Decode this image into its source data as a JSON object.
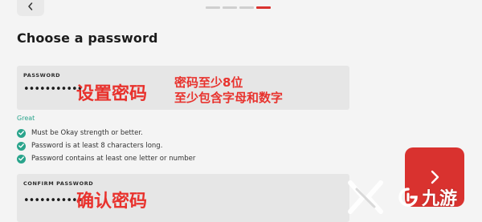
{
  "progress": {
    "total": 4,
    "current": 4
  },
  "page_title": "Choose a password",
  "password_field": {
    "label": "PASSWORD",
    "value": "•••••••••••"
  },
  "confirm_field": {
    "label": "CONFIRM PASSWORD",
    "value": "•••••••••••"
  },
  "strength_label": "Great",
  "requirements": [
    "Must be Okay strength or better.",
    "Password is at least 8 characters long.",
    "Password contains at least one letter or number"
  ],
  "annotations": {
    "set_password": "设置密码",
    "rule_line1": "密码至少8位",
    "rule_line2": "至少包含字母和数字",
    "confirm_password": "确认密码"
  },
  "watermark": {
    "text": "九游"
  },
  "colors": {
    "accent": "#d9322f",
    "success": "#2aa48c",
    "field_bg": "#e6e6e6",
    "annotation": "#e8322d"
  },
  "icons": {
    "back": "chevron-left-icon",
    "next": "chevron-right-icon",
    "check": "check-circle-icon"
  }
}
